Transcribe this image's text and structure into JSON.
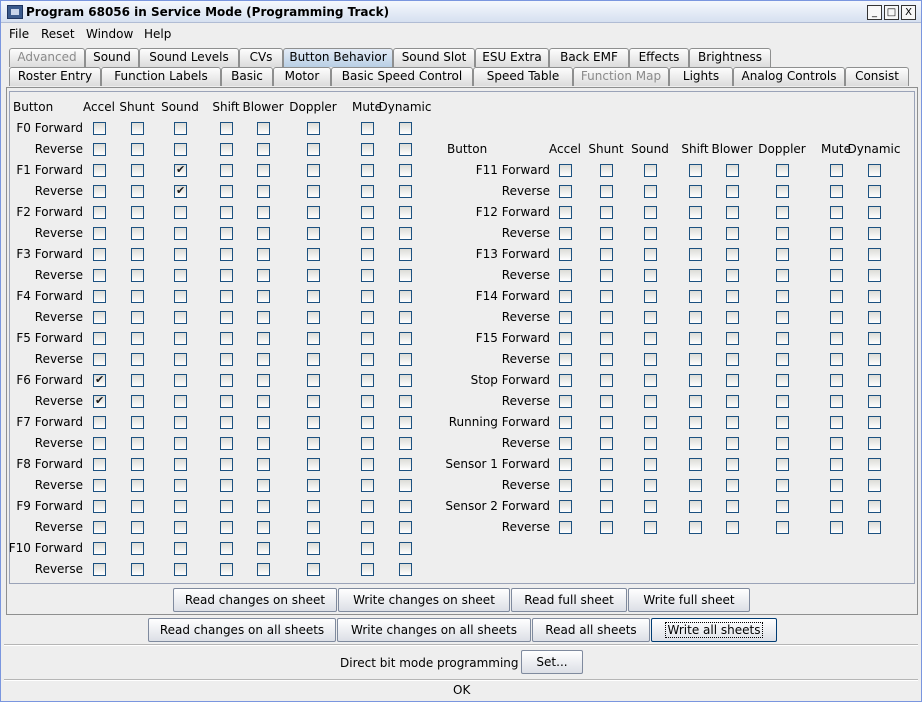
{
  "window": {
    "title": "Program 68056 in Service Mode (Programming Track)",
    "min": "_",
    "max": "□",
    "close": "X"
  },
  "menu": [
    "File",
    "Reset",
    "Window",
    "Help"
  ],
  "tabs_row1": [
    {
      "label": "Advanced",
      "state": "disabled"
    },
    {
      "label": "Sound",
      "state": "normal"
    },
    {
      "label": "Sound Levels",
      "state": "normal"
    },
    {
      "label": "CVs",
      "state": "normal"
    },
    {
      "label": "Button Behavior",
      "state": "selected"
    },
    {
      "label": "Sound Slot",
      "state": "normal"
    },
    {
      "label": "ESU Extra",
      "state": "normal"
    },
    {
      "label": "Back EMF",
      "state": "normal"
    },
    {
      "label": "Effects",
      "state": "normal"
    },
    {
      "label": "Brightness",
      "state": "normal"
    }
  ],
  "tabs_row2": [
    {
      "label": "Roster Entry",
      "state": "normal"
    },
    {
      "label": "Function Labels",
      "state": "normal"
    },
    {
      "label": "Basic",
      "state": "normal"
    },
    {
      "label": "Motor",
      "state": "normal"
    },
    {
      "label": "Basic Speed Control",
      "state": "normal"
    },
    {
      "label": "Speed Table",
      "state": "normal"
    },
    {
      "label": "Function Map",
      "state": "disabled"
    },
    {
      "label": "Lights",
      "state": "normal"
    },
    {
      "label": "Analog Controls",
      "state": "normal"
    },
    {
      "label": "Consist",
      "state": "normal"
    }
  ],
  "table_headers": [
    "Button",
    "Accel",
    "Shunt",
    "Sound",
    "Shift",
    "Blower",
    "Doppler",
    "Mute",
    "Dynamic"
  ],
  "left_rows": [
    {
      "label": "F0 Forward",
      "checked": [
        false,
        false,
        false,
        false,
        false,
        false,
        false,
        false
      ]
    },
    {
      "label": "Reverse",
      "checked": [
        false,
        false,
        false,
        false,
        false,
        false,
        false,
        false
      ]
    },
    {
      "label": "F1 Forward",
      "checked": [
        false,
        false,
        true,
        false,
        false,
        false,
        false,
        false
      ]
    },
    {
      "label": "Reverse",
      "checked": [
        false,
        false,
        true,
        false,
        false,
        false,
        false,
        false
      ]
    },
    {
      "label": "F2 Forward",
      "checked": [
        false,
        false,
        false,
        false,
        false,
        false,
        false,
        false
      ]
    },
    {
      "label": "Reverse",
      "checked": [
        false,
        false,
        false,
        false,
        false,
        false,
        false,
        false
      ]
    },
    {
      "label": "F3 Forward",
      "checked": [
        false,
        false,
        false,
        false,
        false,
        false,
        false,
        false
      ]
    },
    {
      "label": "Reverse",
      "checked": [
        false,
        false,
        false,
        false,
        false,
        false,
        false,
        false
      ]
    },
    {
      "label": "F4 Forward",
      "checked": [
        false,
        false,
        false,
        false,
        false,
        false,
        false,
        false
      ]
    },
    {
      "label": "Reverse",
      "checked": [
        false,
        false,
        false,
        false,
        false,
        false,
        false,
        false
      ]
    },
    {
      "label": "F5 Forward",
      "checked": [
        false,
        false,
        false,
        false,
        false,
        false,
        false,
        false
      ]
    },
    {
      "label": "Reverse",
      "checked": [
        false,
        false,
        false,
        false,
        false,
        false,
        false,
        false
      ]
    },
    {
      "label": "F6 Forward",
      "checked": [
        true,
        false,
        false,
        false,
        false,
        false,
        false,
        false
      ]
    },
    {
      "label": "Reverse",
      "checked": [
        true,
        false,
        false,
        false,
        false,
        false,
        false,
        false
      ]
    },
    {
      "label": "F7 Forward",
      "checked": [
        false,
        false,
        false,
        false,
        false,
        false,
        false,
        false
      ]
    },
    {
      "label": "Reverse",
      "checked": [
        false,
        false,
        false,
        false,
        false,
        false,
        false,
        false
      ]
    },
    {
      "label": "F8 Forward",
      "checked": [
        false,
        false,
        false,
        false,
        false,
        false,
        false,
        false
      ]
    },
    {
      "label": "Reverse",
      "checked": [
        false,
        false,
        false,
        false,
        false,
        false,
        false,
        false
      ]
    },
    {
      "label": "F9 Forward",
      "checked": [
        false,
        false,
        false,
        false,
        false,
        false,
        false,
        false
      ]
    },
    {
      "label": "Reverse",
      "checked": [
        false,
        false,
        false,
        false,
        false,
        false,
        false,
        false
      ]
    },
    {
      "label": "F10 Forward",
      "checked": [
        false,
        false,
        false,
        false,
        false,
        false,
        false,
        false
      ]
    },
    {
      "label": "Reverse",
      "checked": [
        false,
        false,
        false,
        false,
        false,
        false,
        false,
        false
      ]
    }
  ],
  "right_rows": [
    {
      "label": "F11 Forward",
      "checked": [
        false,
        false,
        false,
        false,
        false,
        false,
        false,
        false
      ]
    },
    {
      "label": "Reverse",
      "checked": [
        false,
        false,
        false,
        false,
        false,
        false,
        false,
        false
      ]
    },
    {
      "label": "F12 Forward",
      "checked": [
        false,
        false,
        false,
        false,
        false,
        false,
        false,
        false
      ]
    },
    {
      "label": "Reverse",
      "checked": [
        false,
        false,
        false,
        false,
        false,
        false,
        false,
        false
      ]
    },
    {
      "label": "F13 Forward",
      "checked": [
        false,
        false,
        false,
        false,
        false,
        false,
        false,
        false
      ]
    },
    {
      "label": "Reverse",
      "checked": [
        false,
        false,
        false,
        false,
        false,
        false,
        false,
        false
      ]
    },
    {
      "label": "F14 Forward",
      "checked": [
        false,
        false,
        false,
        false,
        false,
        false,
        false,
        false
      ]
    },
    {
      "label": "Reverse",
      "checked": [
        false,
        false,
        false,
        false,
        false,
        false,
        false,
        false
      ]
    },
    {
      "label": "F15 Forward",
      "checked": [
        false,
        false,
        false,
        false,
        false,
        false,
        false,
        false
      ]
    },
    {
      "label": "Reverse",
      "checked": [
        false,
        false,
        false,
        false,
        false,
        false,
        false,
        false
      ]
    },
    {
      "label": "Stop Forward",
      "checked": [
        false,
        false,
        false,
        false,
        false,
        false,
        false,
        false
      ]
    },
    {
      "label": "Reverse",
      "checked": [
        false,
        false,
        false,
        false,
        false,
        false,
        false,
        false
      ]
    },
    {
      "label": "Running Forward",
      "checked": [
        false,
        false,
        false,
        false,
        false,
        false,
        false,
        false
      ]
    },
    {
      "label": "Reverse",
      "checked": [
        false,
        false,
        false,
        false,
        false,
        false,
        false,
        false
      ]
    },
    {
      "label": "Sensor 1 Forward",
      "checked": [
        false,
        false,
        false,
        false,
        false,
        false,
        false,
        false
      ]
    },
    {
      "label": "Reverse",
      "checked": [
        false,
        false,
        false,
        false,
        false,
        false,
        false,
        false
      ]
    },
    {
      "label": "Sensor 2 Forward",
      "checked": [
        false,
        false,
        false,
        false,
        false,
        false,
        false,
        false
      ]
    },
    {
      "label": "Reverse",
      "checked": [
        false,
        false,
        false,
        false,
        false,
        false,
        false,
        false
      ]
    }
  ],
  "sheet_buttons": [
    "Read changes on sheet",
    "Write changes on sheet",
    "Read full sheet",
    "Write full sheet"
  ],
  "all_buttons": [
    "Read changes on all sheets",
    "Write changes on all sheets",
    "Read all sheets",
    "Write all sheets"
  ],
  "direct_bit": {
    "label": "Direct bit mode programming",
    "button": "Set..."
  },
  "status": "OK"
}
